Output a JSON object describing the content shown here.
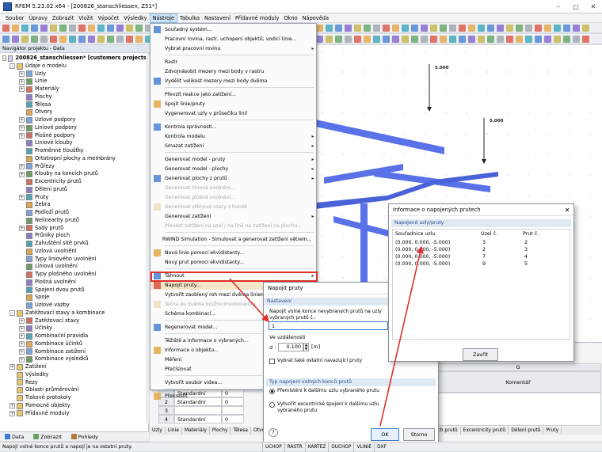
{
  "window": {
    "title": "RFEM 5.23.02 x64 - [200826_stanschliessen, Z51*]",
    "controls": [
      "–",
      "□",
      "✕"
    ]
  },
  "menubar": [
    "Soubor",
    "Úpravy",
    "Zobrazit",
    "Vložit",
    "Výpočet",
    "Výsledky",
    "Nástroje",
    "Tabulka",
    "Nastavení",
    "Přídavné moduly",
    "Okno",
    "Nápověda"
  ],
  "navigator": {
    "header": "Navigátor projektu - Data",
    "root": "200826_stanschliessen* [customers projects]",
    "tree": [
      {
        "label": "Údaje o modelu",
        "level": 1,
        "exp": "–"
      },
      {
        "label": "Uzly",
        "level": 2,
        "exp": "+"
      },
      {
        "label": "Linie",
        "level": 2,
        "exp": "+"
      },
      {
        "label": "Materiály",
        "level": 2,
        "exp": "+"
      },
      {
        "label": "Plochy",
        "level": 2,
        "exp": ""
      },
      {
        "label": "Tělesa",
        "level": 2,
        "exp": ""
      },
      {
        "label": "Otvory",
        "level": 2,
        "exp": ""
      },
      {
        "label": "Uzlové podpory",
        "level": 2,
        "exp": "+"
      },
      {
        "label": "Liniové podpory",
        "level": 2,
        "exp": "+"
      },
      {
        "label": "Plošné podpory",
        "level": 2,
        "exp": "+"
      },
      {
        "label": "Liniové klouby",
        "level": 2,
        "exp": ""
      },
      {
        "label": "Proměnné tloušťky",
        "level": 2,
        "exp": ""
      },
      {
        "label": "Ortotropní plochy a membrány",
        "level": 2,
        "exp": ""
      },
      {
        "label": "Průřezy",
        "level": 2,
        "exp": "+"
      },
      {
        "label": "Klouby na koncích prutů",
        "level": 2,
        "exp": "+"
      },
      {
        "label": "Excentricity prutů",
        "level": 2,
        "exp": ""
      },
      {
        "label": "Dělení prutů",
        "level": 2,
        "exp": ""
      },
      {
        "label": "Pruty",
        "level": 2,
        "exp": "+"
      },
      {
        "label": "Žebra",
        "level": 2,
        "exp": ""
      },
      {
        "label": "Podloží prutů",
        "level": 2,
        "exp": ""
      },
      {
        "label": "Nelinearity prutů",
        "level": 2,
        "exp": ""
      },
      {
        "label": "Sady prutů",
        "level": 2,
        "exp": "+"
      },
      {
        "label": "Průniky ploch",
        "level": 2,
        "exp": ""
      },
      {
        "label": "Zahuštění sítě prvků",
        "level": 2,
        "exp": ""
      },
      {
        "label": "Uzlová uvolnění",
        "level": 2,
        "exp": ""
      },
      {
        "label": "Typy liniového uvolnění",
        "level": 2,
        "exp": ""
      },
      {
        "label": "Liniová uvolnění",
        "level": 2,
        "exp": ""
      },
      {
        "label": "Typy plošného uvolnění",
        "level": 2,
        "exp": ""
      },
      {
        "label": "Plošná uvolnění",
        "level": 2,
        "exp": ""
      },
      {
        "label": "Spojení dvou prutů",
        "level": 2,
        "exp": ""
      },
      {
        "label": "Spoje",
        "level": 2,
        "exp": ""
      },
      {
        "label": "Uzlové vazby",
        "level": 2,
        "exp": ""
      },
      {
        "label": "Zatěžovací stavy a kombinace",
        "level": 1,
        "exp": "–"
      },
      {
        "label": "Zatěžovací stavy",
        "level": 2,
        "exp": "+"
      },
      {
        "label": "Účinky",
        "level": 2,
        "exp": "+"
      },
      {
        "label": "Kombinační pravidla",
        "level": 2,
        "exp": "+"
      },
      {
        "label": "Kombinace účinků",
        "level": 2,
        "exp": "+"
      },
      {
        "label": "Kombinace zatížení",
        "level": 2,
        "exp": "+"
      },
      {
        "label": "Kombinace výsledků",
        "level": 2,
        "exp": "+"
      },
      {
        "label": "Zatížení",
        "level": 1,
        "exp": "+"
      },
      {
        "label": "Výsledky",
        "level": 1,
        "exp": ""
      },
      {
        "label": "Řezy",
        "level": 1,
        "exp": ""
      },
      {
        "label": "Oblasti průměrování",
        "level": 1,
        "exp": ""
      },
      {
        "label": "Tiskové protokoly",
        "level": 1,
        "exp": ""
      },
      {
        "label": "Pomocné objekty",
        "level": 1,
        "exp": "+"
      },
      {
        "label": "Přídavné moduly",
        "level": 1,
        "exp": "+"
      }
    ],
    "tabs": [
      "Data",
      "Zobrazit",
      "Pohledy"
    ]
  },
  "tools_menu": {
    "items": [
      {
        "label": "Souřadný systém...",
        "dis": false,
        "sub": false
      },
      {
        "label": "Pracovní rovina, rastr, uchopení objektů, vodicí linie...",
        "dis": false,
        "sub": false
      },
      {
        "label": "Vybrat pracovní rovinu",
        "dis": false,
        "sub": true
      },
      {
        "sep": true
      },
      {
        "label": "Rastr",
        "dis": false,
        "sub": false
      },
      {
        "label": "Zdvojnásobit mezery mezi body v rastru",
        "dis": false,
        "sub": false
      },
      {
        "label": "Vydělit velikost mezery mezi body dvěma",
        "dis": false,
        "sub": false
      },
      {
        "sep": true
      },
      {
        "label": "Převzít reakce jako zatížení...",
        "dis": false,
        "sub": false
      },
      {
        "label": "Spojit linie/pruty",
        "dis": false,
        "sub": false
      },
      {
        "label": "Vygenerovat uzly v průsečíku linií",
        "dis": false,
        "sub": false
      },
      {
        "sep": true
      },
      {
        "label": "Kontrola správnosti...",
        "dis": false,
        "sub": false
      },
      {
        "label": "Kontrola modelu",
        "dis": false,
        "sub": true
      },
      {
        "label": "Smazat zatížení",
        "dis": false,
        "sub": true
      },
      {
        "sep": true
      },
      {
        "label": "Generovat model - pruty",
        "dis": false,
        "sub": true
      },
      {
        "label": "Generovat model - plochy",
        "dis": false,
        "sub": true
      },
      {
        "label": "Generovat plochy z prutů",
        "dis": false,
        "sub": true
      },
      {
        "label": "Generovat liniová uvolnění...",
        "dis": true,
        "sub": false
      },
      {
        "label": "Generovat plošná uvolnění...",
        "dis": true,
        "sub": false
      },
      {
        "label": "Generovat stěnové vzory z buněk",
        "dis": true,
        "sub": false
      },
      {
        "label": "Generovat zatížení",
        "dis": false,
        "sub": true
      },
      {
        "label": "Převést zatížení na uzel / na linii na zatížení na plochu...",
        "dis": true,
        "sub": false
      },
      {
        "sep": true
      },
      {
        "label": "RWIND Simulation - Simulovat a generovat zatížení větrem...",
        "dis": false,
        "sub": false
      },
      {
        "sep": true
      },
      {
        "label": "Nová linie pomocí ekvidistanty...",
        "dis": false,
        "sub": false
      },
      {
        "label": "Nový prut pomocí ekvidistanty...",
        "dis": false,
        "sub": false
      },
      {
        "sep": true
      },
      {
        "label": "Táhnout",
        "dis": false,
        "sub": true
      },
      {
        "label": "Napojit pruty...",
        "dis": false,
        "sub": false,
        "hl": true
      },
      {
        "label": "Vytvořit zaoblený roh mezi dvěma liniemi",
        "dis": false,
        "sub": false
      },
      {
        "label": "Tečna ke dvěma kružnicím/obloukům...",
        "dis": true,
        "sub": false
      },
      {
        "label": "Schéma kombinací...",
        "dis": false,
        "sub": false
      },
      {
        "sep": true
      },
      {
        "label": "Regenerovat model...",
        "dis": false,
        "sub": false
      },
      {
        "sep": true
      },
      {
        "label": "Těžiště a informace o vybraných...",
        "dis": false,
        "sub": false
      },
      {
        "label": "Informace o objektu...",
        "dis": false,
        "sub": false
      },
      {
        "label": "Měření",
        "dis": false,
        "sub": true
      },
      {
        "label": "Přečíslovat",
        "dis": false,
        "sub": true
      },
      {
        "sep": true
      },
      {
        "label": "Vytvořit soubor videa...",
        "dis": false,
        "sub": false
      },
      {
        "sep": true
      },
      {
        "label": "Překreslit",
        "dis": false,
        "sub": false
      }
    ]
  },
  "viewport": {
    "load1": "5.000",
    "load2": "5.000"
  },
  "connect_dialog": {
    "title": "Napojit pruty",
    "section1": "Nastavení",
    "desc": "Napojit volné konce nevybraných prutů na uzly vybraných prutů č.:",
    "members_value": "1",
    "within_label": "Ve vzdálenosti",
    "d_label": "d :",
    "d_value": "0.100",
    "d_unit": "[m]",
    "checkbox_label": "Vybrat také ostatní navazující pruty",
    "section2": "Typ napojení volných konců prutů",
    "radio1": "Přemístění k dalšímu uzlu vybraného prutu",
    "radio2": "Vytvořit excentrické spojení k dalšímu uzlu vybraného prutu",
    "ok": "OK",
    "cancel": "Storno"
  },
  "info_dialog": {
    "title": "Informace o napojených prutech",
    "section": "Napojené uzly/pruty",
    "col1": "Souřadnice uzlu",
    "col2": "Uzel č.",
    "col3": "Prut č.",
    "rows": [
      [
        "(0.000, 0.000, -5.000)",
        "3",
        "2"
      ],
      [
        "(0.000, 0.000, -5.000)",
        "2",
        "3"
      ],
      [
        "(0.000, 0.000, -5.000)",
        "7",
        "4"
      ],
      [
        "(0.000, 0.000, -5.000)",
        "9",
        "5"
      ]
    ],
    "button": "Zavřít"
  },
  "bottom_table": {
    "col_g": "G",
    "col_comment": "Komentář",
    "rows": [
      [
        "",
        "Standardní",
        "0"
      ],
      [
        "2",
        "Standardní",
        "0"
      ],
      [
        "3",
        "",
        ""
      ],
      [
        "4",
        "Standardní",
        "0"
      ]
    ],
    "tabs_left": [
      "Uzly",
      "Linie",
      "Materiály",
      "Plochy",
      "Tělesa",
      "Otvory"
    ],
    "tabs_right": [
      "na koncích prutů",
      "Excentricity prutů",
      "Dělení prutů",
      "Pruty"
    ]
  },
  "statusbar": {
    "message": "Napojí volné konce prutů a napojí je na ostatní pruty.",
    "buttons": [
      "UCHOP",
      "RASTR",
      "KARTEZ",
      "OUCHOP",
      "VLINIE",
      "DXF"
    ]
  },
  "colors": {
    "accent": "#e0302a",
    "member": "#5a72e8",
    "load": "#222222"
  }
}
